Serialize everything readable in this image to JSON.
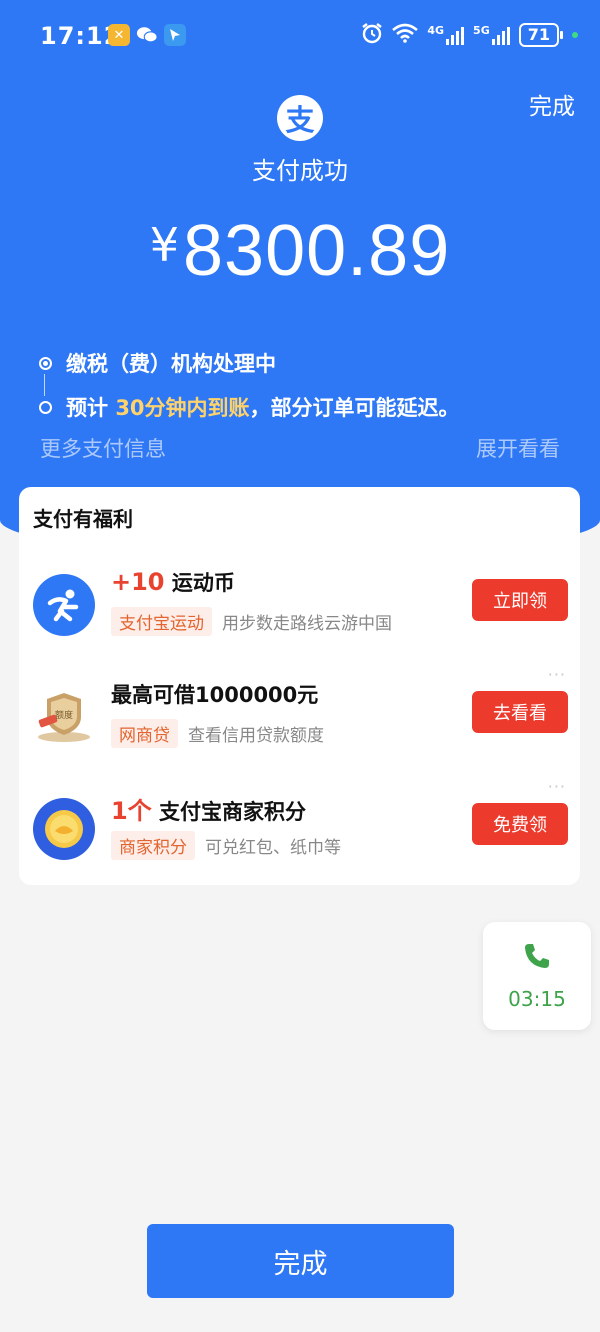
{
  "status_bar": {
    "time": "17:12",
    "network_4g": "4G",
    "network_5g": "5G",
    "battery": "71"
  },
  "header": {
    "done_label": "完成",
    "logo_glyph": "支",
    "title": "支付成功",
    "currency": "¥",
    "amount": "8300.89"
  },
  "progress": {
    "step1": "缴税（费）机构处理中",
    "step2_prefix": "预计 ",
    "step2_highlight": "30分钟内到账",
    "step2_suffix": "，部分订单可能延迟。",
    "more_info": "更多支付信息",
    "expand": "展开看看"
  },
  "benefits": {
    "title": "支付有福利",
    "items": [
      {
        "amount": "+10",
        "name": " 运动币",
        "tag": "支付宝运动",
        "desc": "用步数走路线云游中国",
        "button": "立即领"
      },
      {
        "amount": "",
        "name": "最高可借1000000元",
        "tag": "网商贷",
        "desc": "查看信用贷款额度",
        "button": "去看看",
        "badge_text": "额度"
      },
      {
        "amount": "1个",
        "name": " 支付宝商家积分",
        "tag": "商家积分",
        "desc": "可兑红包、纸巾等",
        "button": "免费领"
      }
    ],
    "more_dots": "···"
  },
  "call_widget": {
    "timer": "03:15"
  },
  "footer": {
    "done_button": "完成"
  },
  "colors": {
    "brand_blue": "#2f78f5",
    "action_red": "#ec3a2d",
    "highlight_yellow": "#ffd36b",
    "call_green": "#3ea34a"
  }
}
